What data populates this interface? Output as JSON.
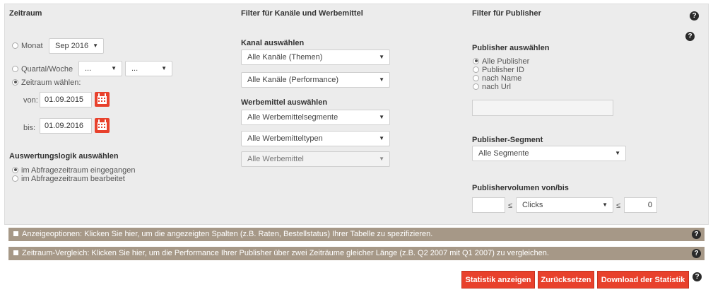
{
  "headers": {
    "zeitraum": "Zeitraum",
    "filter_kanaele": "Filter für Kanäle und Werbemittel",
    "filter_publisher": "Filter für Publisher"
  },
  "zeitraum": {
    "monat_label": "Monat",
    "monat_value": "Sep 2016",
    "quartal_label": "Quartal/Woche",
    "quartal_value": "...",
    "woche_value": "...",
    "zeitraum_label": "Zeitraum wählen:",
    "von_label": "von:",
    "von_value": "01.09.2015",
    "bis_label": "bis:",
    "bis_value": "01.09.2016",
    "selected": "zeitraum"
  },
  "logik": {
    "title": "Auswertungslogik auswählen",
    "option1": "im Abfragezeitraum eingegangen",
    "option2": "im Abfragezeitraum bearbeitet",
    "selected": "option1"
  },
  "kanal": {
    "title": "Kanal auswählen",
    "themen": "Alle Kanäle (Themen)",
    "performance": "Alle Kanäle (Performance)"
  },
  "werbemittel": {
    "title": "Werbemittel auswählen",
    "segmente": "Alle Werbemittelsegmente",
    "typen": "Alle Werbemitteltypen",
    "mittel": "Alle Werbemittel"
  },
  "publisher": {
    "title": "Publisher auswählen",
    "options": [
      "Alle Publisher",
      "Publisher ID",
      "nach Name",
      "nach Url"
    ],
    "selected_index": 0,
    "search_value": "",
    "segment_title": "Publisher-Segment",
    "segment_value": "Alle Segmente",
    "volumen_title": "Publishervolumen von/bis",
    "volumen_from": "",
    "leq": "≤",
    "volumen_metric": "Clicks",
    "volumen_to": "0"
  },
  "bars": {
    "anzeigeoptionen": "Anzeigeoptionen: Klicken Sie hier, um die angezeigten Spalten (z.B. Raten, Bestellstatus) Ihrer Tabelle zu spezifizieren.",
    "vergleich": "Zeitraum-Vergleich: Klicken Sie hier, um die Performance Ihrer Publisher über zwei Zeiträume gleicher Länge (z.B. Q2 2007 mit Q1 2007) zu vergleichen."
  },
  "buttons": {
    "anzeigen": "Statistik anzeigen",
    "zuruecksetzen": "Zurücksetzen",
    "download": "Download der Statistik"
  },
  "help_glyph": "?",
  "icons": {
    "help": "question-circle-icon",
    "calendar": "calendar-icon",
    "dropdown": "chevron-down-icon"
  },
  "colors": {
    "accent_red": "#e8412c",
    "bar_taupe": "#a69887",
    "panel_bg": "#ececec"
  }
}
